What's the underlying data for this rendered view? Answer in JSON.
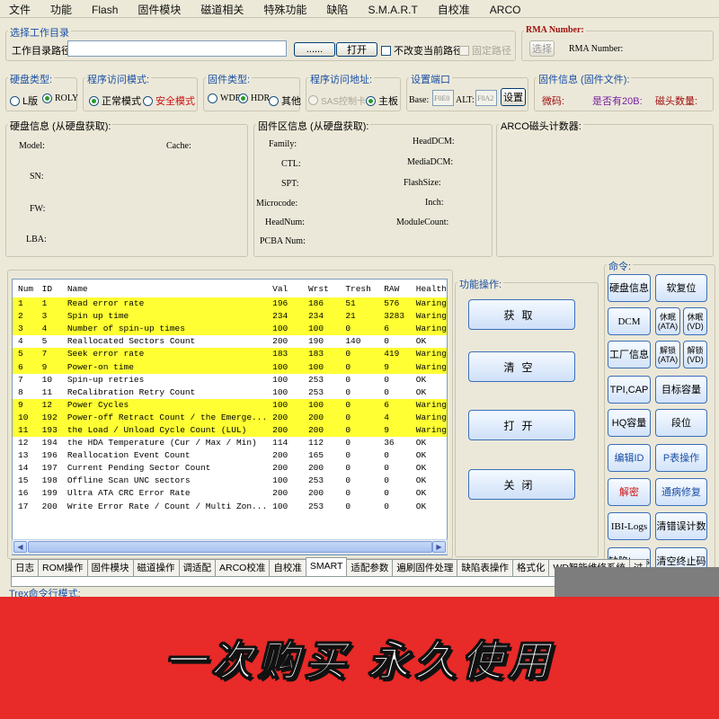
{
  "menu": [
    "文件",
    "功能",
    "Flash",
    "固件模块",
    "磁道相关",
    "特殊功能",
    "缺陷",
    "S.M.A.R.T",
    "自校准",
    "ARCO"
  ],
  "workdir": {
    "group_label": "选择工作目录",
    "path_label": "工作目录路径:",
    "path_value": "",
    "browse_label": "......",
    "open_label": "打开",
    "keep_current_label": "不改变当前路径",
    "fixed_path_label": "固定路径"
  },
  "rma": {
    "group_label": "RMA Number:",
    "select_label": "选择",
    "number_label": "RMA Number:"
  },
  "disk_type": {
    "group_label": "硬盘类型:",
    "options": [
      {
        "label": "L版",
        "selected": false
      },
      {
        "label": "ROLY",
        "selected": true
      }
    ]
  },
  "access_mode": {
    "group_label": "程序访问模式:",
    "options": [
      {
        "label": "正常模式",
        "selected": true
      },
      {
        "label": "安全模式",
        "selected": false
      }
    ]
  },
  "firmware_type": {
    "group_label": "固件类型:",
    "options": [
      {
        "label": "WDR",
        "selected": false
      },
      {
        "label": "HDR",
        "selected": true
      },
      {
        "label": "其他",
        "selected": false
      }
    ]
  },
  "access_addr": {
    "group_label": "程序访问地址:",
    "options": [
      {
        "label": "SAS控制卡",
        "selected": false,
        "disabled": true
      },
      {
        "label": "主板",
        "selected": true,
        "disabled": false
      }
    ]
  },
  "port": {
    "group_label": "设置端口",
    "base_label": "Base:",
    "base_value": "F0E0",
    "alt_label": "ALT:",
    "alt_value": "F0A2",
    "set_label": "设置"
  },
  "fw_info": {
    "group_label": "固件信息 (固件文件):",
    "code_label": "微码:",
    "is20b_label": "是否有20B:",
    "head_count_label": "磁头数量:"
  },
  "disk_info": {
    "group_label": "硬盘信息 (从硬盘获取):",
    "model_label": "Model:",
    "cache_label": "Cache:",
    "sn_label": "SN:",
    "fw_label": "FW:",
    "lba_label": "LBA:"
  },
  "fw_area": {
    "group_label": "固件区信息 (从硬盘获取):",
    "left_labels": [
      "Family:",
      "CTL:",
      "SPT:",
      "Microcode:",
      "HeadNum:",
      "PCBA Num:"
    ],
    "right_labels": [
      "HeadDCM:",
      "MediaDCM:",
      "FlashSize:",
      "Inch:",
      "ModuleCount:"
    ]
  },
  "arco": {
    "group_label": "ARCO磁头计数器:"
  },
  "smart": {
    "columns": [
      "Num",
      "ID",
      "Name",
      "Val",
      "Wrst",
      "Tresh",
      "RAW",
      "Health"
    ],
    "rows": [
      {
        "num": "1",
        "id": "1",
        "name": "Read error rate",
        "val": "196",
        "wrst": "186",
        "tresh": "51",
        "raw": "576",
        "health": "Waring",
        "warn": true
      },
      {
        "num": "2",
        "id": "3",
        "name": "Spin up time",
        "val": "234",
        "wrst": "234",
        "tresh": "21",
        "raw": "3283",
        "health": "Waring",
        "warn": true
      },
      {
        "num": "3",
        "id": "4",
        "name": "Number of spin-up times",
        "val": "100",
        "wrst": "100",
        "tresh": "0",
        "raw": "6",
        "health": "Waring",
        "warn": true
      },
      {
        "num": "4",
        "id": "5",
        "name": "Reallocated Sectors Count",
        "val": "200",
        "wrst": "190",
        "tresh": "140",
        "raw": "0",
        "health": "OK",
        "warn": false
      },
      {
        "num": "5",
        "id": "7",
        "name": "Seek error rate",
        "val": "183",
        "wrst": "183",
        "tresh": "0",
        "raw": "419",
        "health": "Waring",
        "warn": true
      },
      {
        "num": "6",
        "id": "9",
        "name": "Power-on time",
        "val": "100",
        "wrst": "100",
        "tresh": "0",
        "raw": "9",
        "health": "Waring",
        "warn": true
      },
      {
        "num": "7",
        "id": "10",
        "name": "Spin-up retries",
        "val": "100",
        "wrst": "253",
        "tresh": "0",
        "raw": "0",
        "health": "OK",
        "warn": false
      },
      {
        "num": "8",
        "id": "11",
        "name": "ReCalibration Retry Count",
        "val": "100",
        "wrst": "253",
        "tresh": "0",
        "raw": "0",
        "health": "OK",
        "warn": false
      },
      {
        "num": "9",
        "id": "12",
        "name": "Power Cycles",
        "val": "100",
        "wrst": "100",
        "tresh": "0",
        "raw": "6",
        "health": "Waring",
        "warn": true
      },
      {
        "num": "10",
        "id": "192",
        "name": "Power-off Retract Count / the Emerge...",
        "val": "200",
        "wrst": "200",
        "tresh": "0",
        "raw": "4",
        "health": "Waring",
        "warn": true
      },
      {
        "num": "11",
        "id": "193",
        "name": "the Load / Unload Cycle Count (LUL)",
        "val": "200",
        "wrst": "200",
        "tresh": "0",
        "raw": "9",
        "health": "Waring",
        "warn": true
      },
      {
        "num": "12",
        "id": "194",
        "name": "the HDA Temperature (Cur / Max / Min)",
        "val": "114",
        "wrst": "112",
        "tresh": "0",
        "raw": "36",
        "health": "OK",
        "warn": false
      },
      {
        "num": "13",
        "id": "196",
        "name": "Reallocation Event Count",
        "val": "200",
        "wrst": "165",
        "tresh": "0",
        "raw": "0",
        "health": "OK",
        "warn": false
      },
      {
        "num": "14",
        "id": "197",
        "name": "Current Pending Sector Count",
        "val": "200",
        "wrst": "200",
        "tresh": "0",
        "raw": "0",
        "health": "OK",
        "warn": false
      },
      {
        "num": "15",
        "id": "198",
        "name": "Offline Scan UNC sectors",
        "val": "100",
        "wrst": "253",
        "tresh": "0",
        "raw": "0",
        "health": "OK",
        "warn": false
      },
      {
        "num": "16",
        "id": "199",
        "name": "Ultra ATA CRC Error Rate",
        "val": "200",
        "wrst": "200",
        "tresh": "0",
        "raw": "0",
        "health": "OK",
        "warn": false
      },
      {
        "num": "17",
        "id": "200",
        "name": "Write Error Rate / Count / Multi Zon...",
        "val": "100",
        "wrst": "253",
        "tresh": "0",
        "raw": "0",
        "health": "OK",
        "warn": false
      }
    ]
  },
  "func_ops": {
    "group_label": "功能操作:",
    "buttons": [
      "获取",
      "清空",
      "打开",
      "关闭"
    ]
  },
  "commands": {
    "group_label": "命令:",
    "buttons": {
      "disk_info": "硬盘信息",
      "soft_reset": "软复位",
      "dcm": "DCM",
      "sleep_ata": "休眠(ATA)",
      "sleep_vd": "休眠(VD)",
      "factory_info": "工厂信息",
      "unlock_ata": "解锁(ATA)",
      "unlock_vd": "解锁(VD)",
      "tpi_cap": "TPI,CAP",
      "target_capacity": "目标容量",
      "hq_capacity": "HQ容量",
      "segment": "段位",
      "edit_id": "编辑ID",
      "p_table_op": "P表操作",
      "decrypt": "解密",
      "channel_repair": "通病修复",
      "ibi_logs": "IBI-Logs",
      "clear_counter": "清错误计数",
      "defect_logs": "缺陷Logs",
      "clear_stop_code": "清空终止码"
    }
  },
  "tabs": [
    "日志",
    "ROM操作",
    "固件模块",
    "磁道操作",
    "调适配",
    "ARCO校准",
    "自校准",
    "SMART",
    "适配参数",
    "遍刷固件处理",
    "缺陷表操作",
    "格式化",
    "WD智能维修系统",
    "过"
  ],
  "active_tab": "SMART",
  "status": {
    "trex_label": "Trex命令行模式:"
  },
  "banner": {
    "text": "一次购买 永久使用"
  },
  "colors": {
    "warn_row": "#ffff33",
    "banner_bg": "#e82a28",
    "group_label_blue": "#1a4fa6"
  }
}
